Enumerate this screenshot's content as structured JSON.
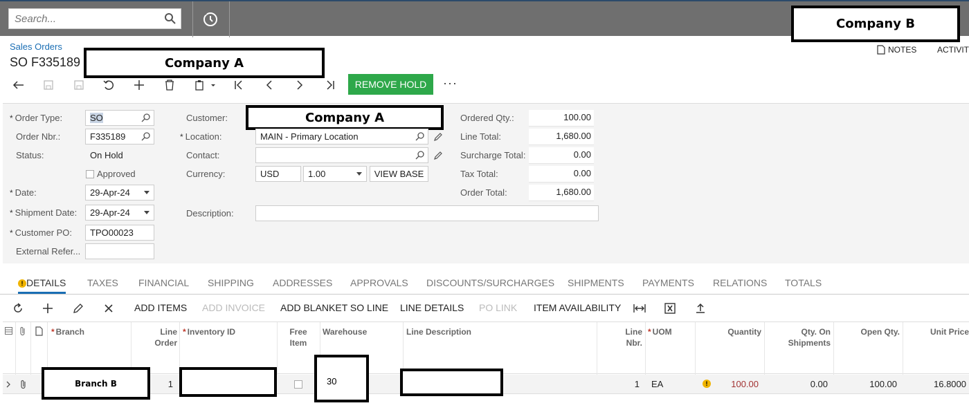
{
  "search": {
    "placeholder": "Search..."
  },
  "company_b": "Company B",
  "breadcrumb": "Sales Orders",
  "title": "SO F335189",
  "company_a_title": "Company A",
  "right_links": {
    "notes": "NOTES",
    "activities": "ACTIVITI"
  },
  "toolbar": {
    "remove_hold": "REMOVE HOLD",
    "more": "···"
  },
  "form": {
    "order_type_label": "Order Type:",
    "order_type": "SO",
    "order_nbr_label": "Order Nbr.:",
    "order_nbr": "F335189",
    "status_label": "Status:",
    "status": "On Hold",
    "approved_label": "Approved",
    "date_label": "Date:",
    "date": "29-Apr-24",
    "shipment_date_label": "Shipment Date:",
    "shipment_date": "29-Apr-24",
    "customer_po_label": "Customer PO:",
    "customer_po": "TPO00023",
    "external_ref_label": "External Refer...",
    "customer_label": "Customer:",
    "customer": "Company A",
    "location_label": "Location:",
    "location": "MAIN - Primary Location",
    "contact_label": "Contact:",
    "currency_label": "Currency:",
    "currency": "USD",
    "rate": "1.00",
    "view_base": "VIEW BASE",
    "description_label": "Description:",
    "ordered_qty_label": "Ordered Qty.:",
    "ordered_qty": "100.00",
    "line_total_label": "Line Total:",
    "line_total": "1,680.00",
    "surcharge_total_label": "Surcharge Total:",
    "surcharge_total": "0.00",
    "tax_total_label": "Tax Total:",
    "tax_total": "0.00",
    "order_total_label": "Order Total:",
    "order_total": "1,680.00"
  },
  "tabs": [
    "DETAILS",
    "TAXES",
    "FINANCIAL",
    "SHIPPING",
    "ADDRESSES",
    "APPROVALS",
    "DISCOUNTS/SURCHARGES",
    "SHIPMENTS",
    "PAYMENTS",
    "RELATIONS",
    "TOTALS"
  ],
  "grid_toolbar": {
    "add_items": "ADD ITEMS",
    "add_invoice": "ADD INVOICE",
    "add_blanket": "ADD BLANKET SO LINE",
    "line_details": "LINE DETAILS",
    "po_link": "PO LINK",
    "item_availability": "ITEM AVAILABILITY"
  },
  "grid_headers": {
    "branch": "Branch",
    "line_order_1": "Line",
    "line_order_2": "Order",
    "inventory_id": "Inventory ID",
    "free_item_1": "Free",
    "free_item_2": "Item",
    "warehouse": "Warehouse",
    "line_description": "Line Description",
    "line_nbr_1": "Line",
    "line_nbr_2": "Nbr.",
    "uom": "UOM",
    "quantity": "Quantity",
    "qty_ship_1": "Qty. On",
    "qty_ship_2": "Shipments",
    "open_qty": "Open Qty.",
    "unit_price": "Unit Price"
  },
  "grid_row": {
    "branch": "Branch B",
    "line_order": "1",
    "warehouse": "30",
    "line_nbr": "1",
    "uom": "EA",
    "quantity": "100.00",
    "qty_on_shipments": "0.00",
    "open_qty": "100.00",
    "unit_price": "16.8000"
  },
  "colors": {
    "accent": "#1a6eb4",
    "hold_button": "#2ea84a",
    "topbar": "#6f6f6f",
    "warning": "#f0b400",
    "qty_red": "#a33333"
  }
}
